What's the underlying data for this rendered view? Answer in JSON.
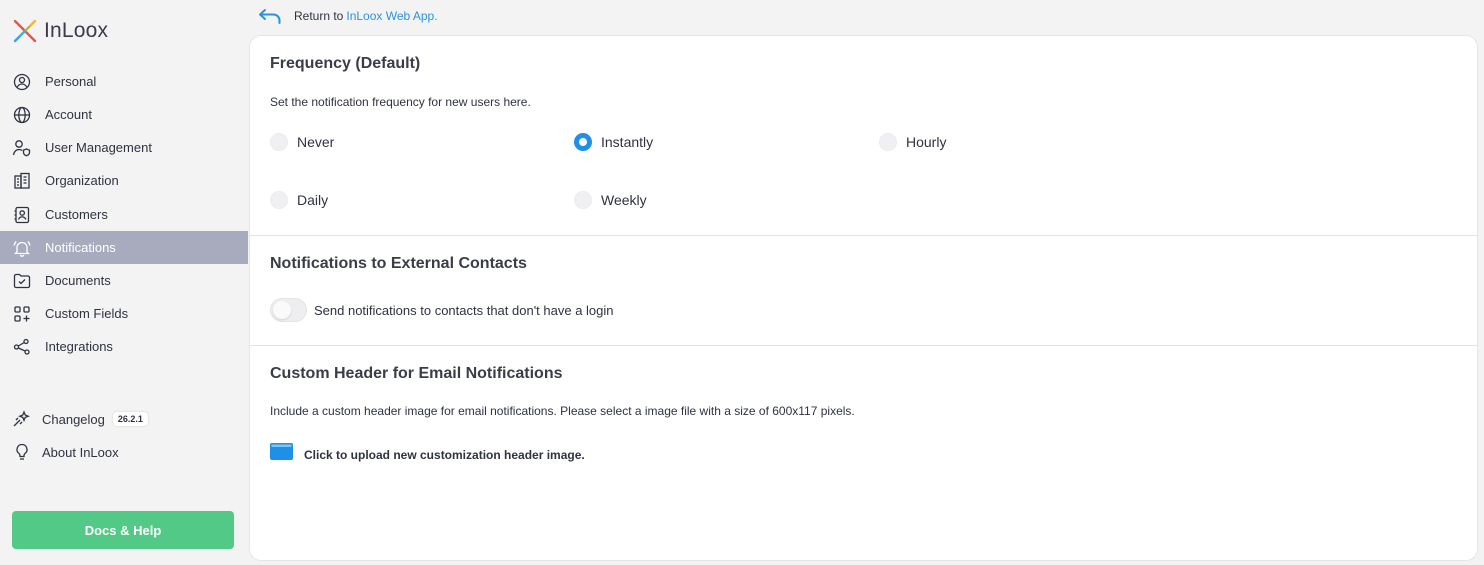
{
  "logo": {
    "text": "InLoox",
    "icon": "inloox-x-logo"
  },
  "sidebar": {
    "items": [
      {
        "label": "Personal",
        "icon": "user-circle-icon"
      },
      {
        "label": "Account",
        "icon": "globe-icon"
      },
      {
        "label": "User Management",
        "icon": "user-shield-icon"
      },
      {
        "label": "Organization",
        "icon": "building-icon"
      },
      {
        "label": "Customers",
        "icon": "contact-card-icon"
      },
      {
        "label": "Notifications",
        "icon": "bell-icon",
        "active": true
      },
      {
        "label": "Documents",
        "icon": "document-check-icon"
      },
      {
        "label": "Custom Fields",
        "icon": "grid-plus-icon"
      },
      {
        "label": "Integrations",
        "icon": "share-nodes-icon"
      }
    ],
    "changelog": {
      "label": "Changelog",
      "version": "26.2.1",
      "icon": "sparkle-icon"
    },
    "about": {
      "label": "About InLoox",
      "icon": "lightbulb-icon"
    },
    "docs_button": "Docs & Help"
  },
  "return": {
    "prefix": "Return to",
    "link": "InLoox Web App."
  },
  "frequency": {
    "title": "Frequency (Default)",
    "description": "Set the notification frequency for new users here.",
    "options": [
      {
        "label": "Never",
        "checked": false
      },
      {
        "label": "Instantly",
        "checked": true
      },
      {
        "label": "Hourly",
        "checked": false
      },
      {
        "label": "Daily",
        "checked": false
      },
      {
        "label": "Weekly",
        "checked": false
      }
    ]
  },
  "external": {
    "title": "Notifications to External Contacts",
    "toggle_label": "Send notifications to contacts that don't have a login",
    "toggle_on": false
  },
  "custom_header": {
    "title": "Custom Header for Email Notifications",
    "description": "Include a custom header image for email notifications. Please select a image file with a size of 600x117 pixels.",
    "upload_label": "Click to upload new customization header image."
  },
  "colors": {
    "accent": "#1e90e8",
    "active_nav": "#a8abbd",
    "docs_button": "#52c987",
    "link": "#2b92de"
  }
}
